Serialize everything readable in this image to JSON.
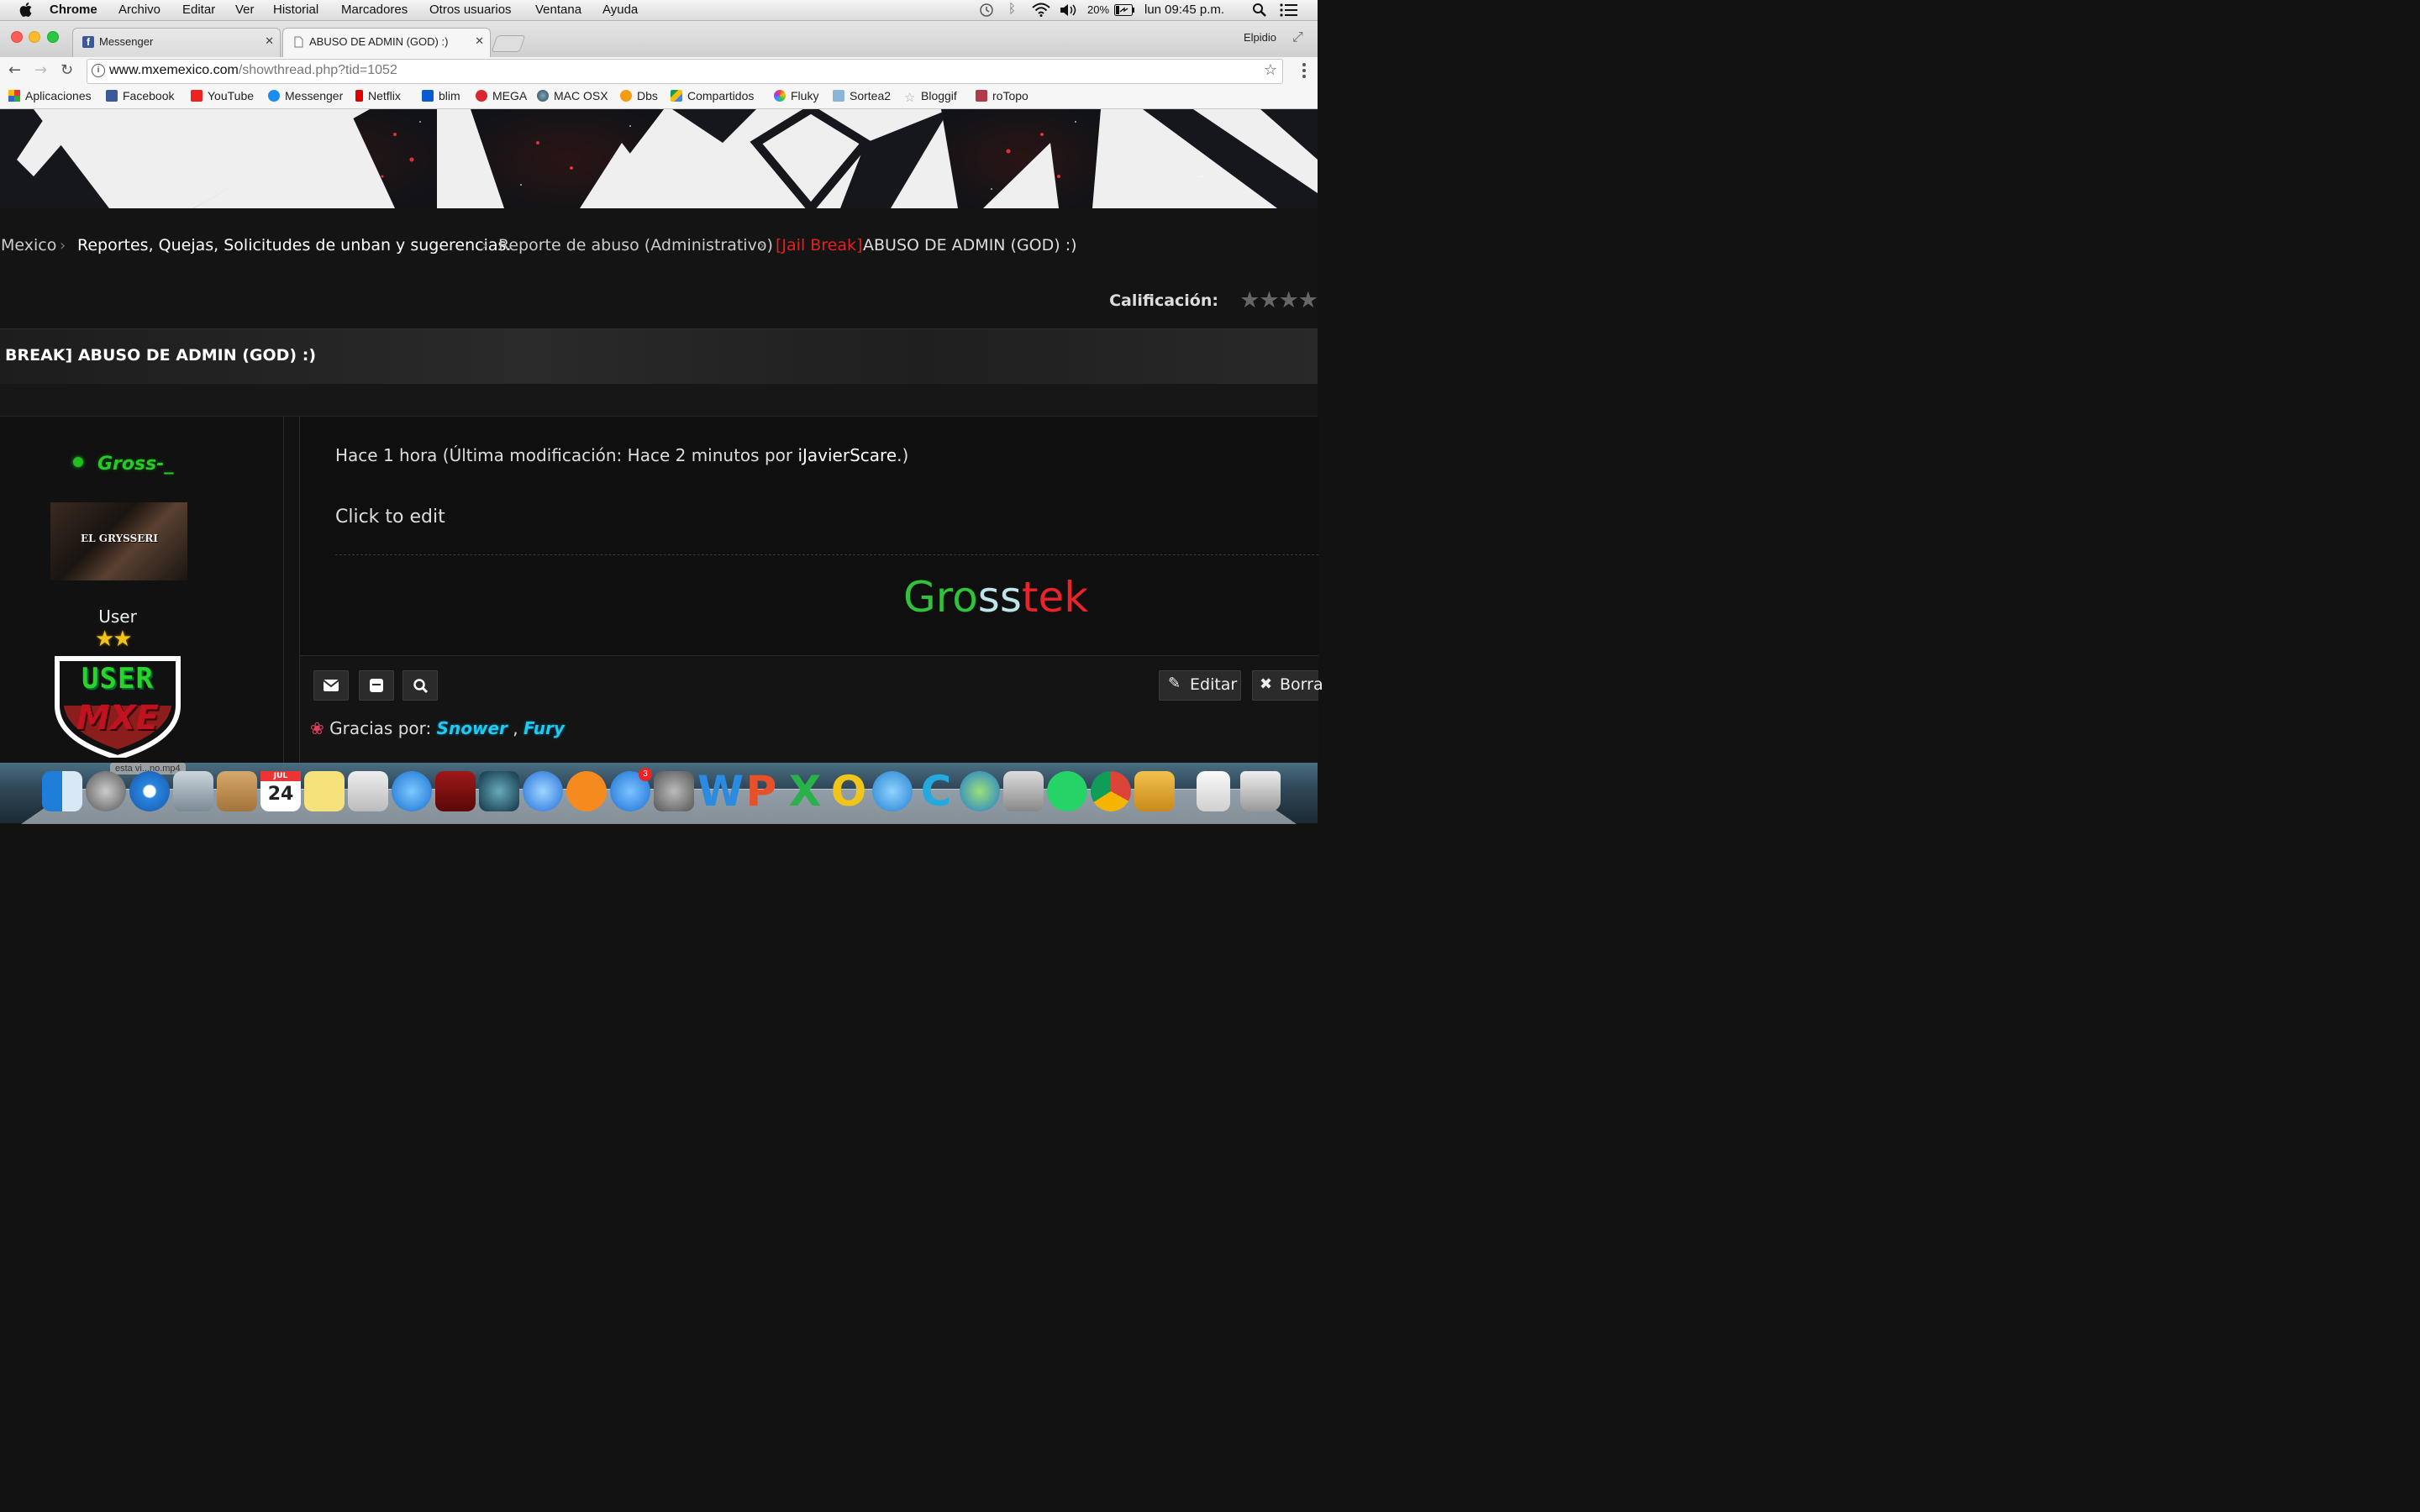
{
  "menubar": {
    "app_name": "Chrome",
    "items": [
      "Archivo",
      "Editar",
      "Ver",
      "Historial",
      "Marcadores",
      "Otros usuarios",
      "Ventana",
      "Ayuda"
    ],
    "battery": "20%",
    "clock": "lun 09:45 p.m."
  },
  "browser": {
    "tabs": [
      {
        "title": "Messenger",
        "active": false
      },
      {
        "title": "ABUSO DE ADMIN (GOD) :)",
        "active": true
      }
    ],
    "profile": "Elpidio",
    "url_host": "www.mxemexico.com",
    "url_path": "/showthread.php?tid=1052",
    "bookmarks": [
      "Aplicaciones",
      "Facebook",
      "YouTube",
      "Messenger",
      "Netflix",
      "blim",
      "MEGA",
      "MAC OSX",
      "Dbs",
      "Compartidos",
      "Fluky",
      "Sortea2",
      "Bloggif",
      "roTopo"
    ]
  },
  "breadcrumb": {
    "items": [
      "Mexico",
      "Reportes, Quejas, Solicitudes de unban y sugerencias.",
      "Reporte de abuso (Administrativo)"
    ],
    "prefix": "[Jail Break]",
    "current": "ABUSO DE ADMIN (GOD) :)"
  },
  "rating": {
    "label": "Calificación:"
  },
  "thread": {
    "title": "BREAK] ABUSO DE ADMIN (GOD) :)"
  },
  "user": {
    "name": "Gross-_",
    "avatar_text": "EL GRYSSERI",
    "rank": "User",
    "badge_top": "USER",
    "badge_bottom": "MXE",
    "status_color": "#1fbf1f"
  },
  "post": {
    "meta_prefix": "Hace 1 hora (Última modificación: Hace 2 minutos por ",
    "meta_user": "iJavierScare",
    "meta_suffix": ".)",
    "body": "Click to edit",
    "signature": [
      {
        "text": "Gro",
        "color": "#2fc23a"
      },
      {
        "text": "ss",
        "color": "#bde6ec"
      },
      {
        "text": "tek",
        "color": "#e8242a"
      }
    ],
    "edit_label": "Editar",
    "delete_label": "Borra",
    "thanks_label": "Gracias por:",
    "thanks_users": [
      "Snower",
      "Fury"
    ]
  },
  "dock": {
    "tooltip": "esta vi...no.mp4",
    "calendar_day": "24",
    "calendar_month": "JUL",
    "appstore_badge": "3"
  }
}
